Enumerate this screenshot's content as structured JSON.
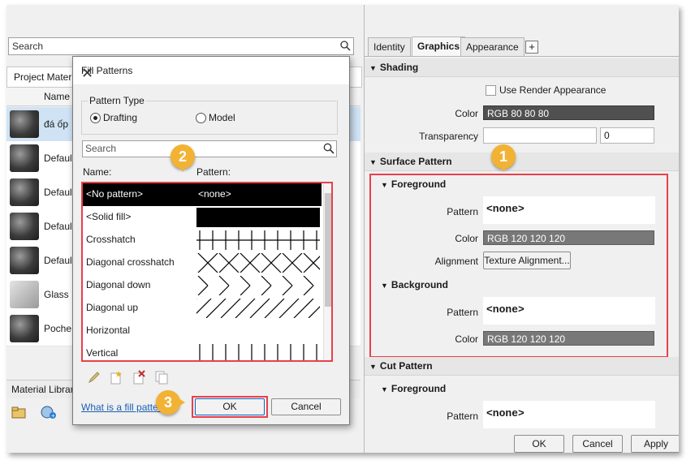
{
  "left_panel": {
    "search_placeholder": "Search",
    "project_materials_label": "Project Materi",
    "column_name": "Name",
    "materials": [
      {
        "name": "đá ốp",
        "thumb": "sphere",
        "selected": true
      },
      {
        "name": "Defaul",
        "thumb": "sphere",
        "selected": false
      },
      {
        "name": "Defaul",
        "thumb": "sphere",
        "selected": false
      },
      {
        "name": "Defaul",
        "thumb": "sphere",
        "selected": false
      },
      {
        "name": "Defaul",
        "thumb": "sphere",
        "selected": false
      },
      {
        "name": "Glass",
        "thumb": "glass",
        "selected": false
      },
      {
        "name": "Poche",
        "thumb": "sphere",
        "selected": false
      }
    ],
    "library_label": "Material Librar"
  },
  "dialog": {
    "title": "Fill Patterns",
    "pattern_type_label": "Pattern Type",
    "options": {
      "drafting": "Drafting",
      "model": "Model"
    },
    "selected_option": "drafting",
    "search_placeholder": "Search",
    "col_name": "Name:",
    "col_pattern": "Pattern:",
    "patterns": [
      {
        "name": "<No pattern>",
        "preview_text": "<none>",
        "preview": "none",
        "selected": true
      },
      {
        "name": "<Solid fill>",
        "preview_text": "",
        "preview": "solid",
        "selected": false
      },
      {
        "name": "Crosshatch",
        "preview_text": "",
        "preview": "crosshatch",
        "selected": false
      },
      {
        "name": "Diagonal crosshatch",
        "preview_text": "",
        "preview": "diag-cross",
        "selected": false
      },
      {
        "name": "Diagonal down",
        "preview_text": "",
        "preview": "diag-down",
        "selected": false
      },
      {
        "name": "Diagonal up",
        "preview_text": "",
        "preview": "diag-up",
        "selected": false
      },
      {
        "name": "Horizontal",
        "preview_text": "",
        "preview": "horizontal",
        "selected": false
      },
      {
        "name": "Vertical",
        "preview_text": "",
        "preview": "vertical",
        "selected": false
      }
    ],
    "help_link": "What is a fill pattern",
    "ok_label": "OK",
    "cancel_label": "Cancel"
  },
  "right_panel": {
    "tabs": [
      "Identity",
      "Graphics",
      "Appearance"
    ],
    "active_tab": "Graphics",
    "add_tab_label": "+",
    "shading": {
      "title": "Shading",
      "use_render_label": "Use Render Appearance",
      "use_render_checked": false,
      "color_label": "Color",
      "color_value": "RGB 80 80 80",
      "transparency_label": "Transparency",
      "transparency_value": "0"
    },
    "surface_pattern": {
      "title": "Surface Pattern",
      "foreground": {
        "title": "Foreground",
        "pattern_label": "Pattern",
        "pattern_value": "<none>",
        "color_label": "Color",
        "color_value": "RGB 120 120 120",
        "alignment_label": "Alignment",
        "alignment_button": "Texture Alignment..."
      },
      "background": {
        "title": "Background",
        "pattern_label": "Pattern",
        "pattern_value": "<none>",
        "color_label": "Color",
        "color_value": "RGB 120 120 120"
      }
    },
    "cut_pattern": {
      "title": "Cut Pattern",
      "foreground": {
        "title": "Foreground",
        "pattern_label": "Pattern",
        "pattern_value": "<none>"
      }
    },
    "bottom_buttons": [
      "OK",
      "Cancel",
      "Apply"
    ]
  },
  "callouts": [
    "1",
    "2",
    "3"
  ],
  "colors": {
    "callout": "#f2b233",
    "highlight": "#e8404a",
    "dark_field": "#505050",
    "gray_field": "#787878"
  }
}
